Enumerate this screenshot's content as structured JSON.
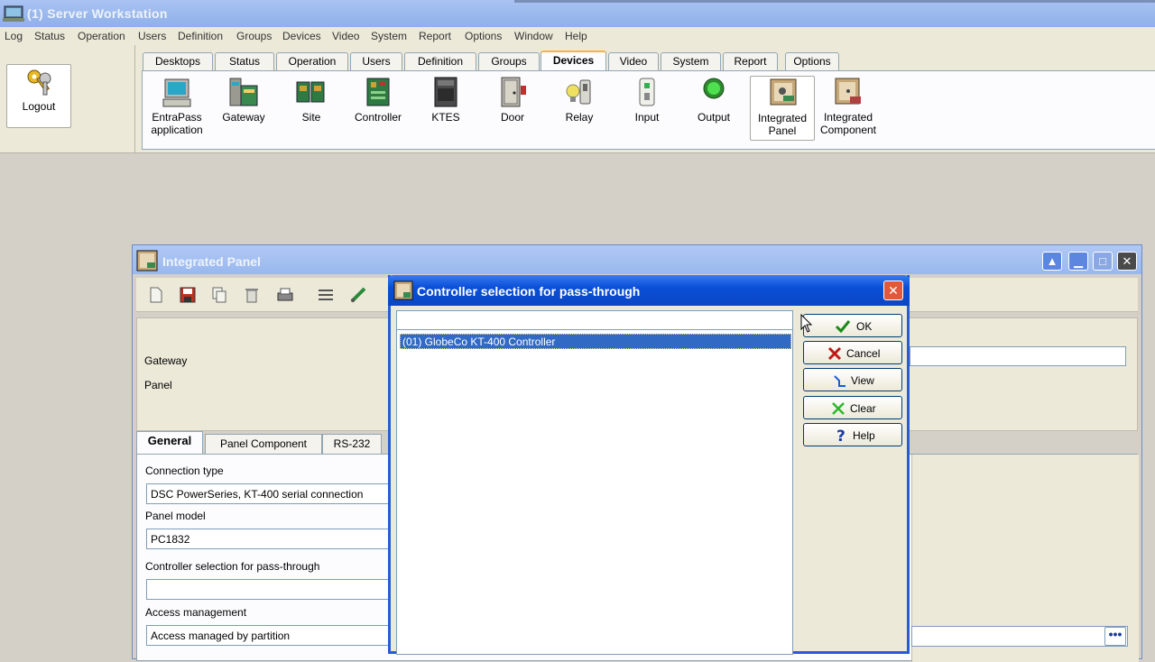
{
  "app": {
    "title": "(1)  Server Workstation"
  },
  "menu": [
    "Log",
    "Status",
    "Operation",
    "Users",
    "Definition",
    "Groups",
    "Devices",
    "Video",
    "System",
    "Report",
    "Options",
    "Window",
    "Help"
  ],
  "logout": {
    "label": "Logout"
  },
  "tabs": [
    "Desktops",
    "Status",
    "Operation",
    "Users",
    "Definition",
    "Groups",
    "Devices",
    "Video",
    "System",
    "Report",
    "Options"
  ],
  "active_tab": "Devices",
  "tools": [
    {
      "label": "EntraPass",
      "label2": "application",
      "icon": "computer-icon"
    },
    {
      "label": "Gateway",
      "label2": "",
      "icon": "gateway-icon"
    },
    {
      "label": "Site",
      "label2": "",
      "icon": "site-icon"
    },
    {
      "label": "Controller",
      "label2": "",
      "icon": "controller-icon"
    },
    {
      "label": "KTES",
      "label2": "",
      "icon": "ktes-icon"
    },
    {
      "label": "Door",
      "label2": "",
      "icon": "door-icon"
    },
    {
      "label": "Relay",
      "label2": "",
      "icon": "relay-icon"
    },
    {
      "label": "Input",
      "label2": "",
      "icon": "input-icon"
    },
    {
      "label": "Output",
      "label2": "",
      "icon": "output-icon"
    },
    {
      "label": "Integrated",
      "label2": "Panel",
      "icon": "integrated-panel-icon"
    },
    {
      "label": "Integrated",
      "label2": "Component",
      "icon": "integrated-component-icon"
    }
  ],
  "integrated_panel": {
    "title": "Integrated Panel",
    "gateway_label": "Gateway",
    "panel_label": "Panel",
    "tabs": [
      "General",
      "Panel Component",
      "RS-232"
    ],
    "connection_type_label": "Connection type",
    "connection_type_value": "DSC PowerSeries, KT-400 serial connection",
    "panel_model_label": "Panel model",
    "panel_model_value": "PC1832",
    "controller_label": "Controller selection for pass-through",
    "controller_value": "",
    "access_label": "Access management",
    "access_value": "Access managed by partition",
    "ellipsis": "•••"
  },
  "dialog": {
    "title": "Controller selection for pass-through",
    "close": "✕",
    "search_value": "",
    "items": [
      "(01) GlobeCo KT-400 Controller"
    ],
    "buttons": {
      "ok": "OK",
      "cancel": "Cancel",
      "view": "View",
      "clear": "Clear",
      "help": "Help"
    }
  },
  "colors": {
    "dialog_title": "#0b46c4",
    "selection": "#316ac5",
    "accent_tab": "#f5b63a"
  }
}
